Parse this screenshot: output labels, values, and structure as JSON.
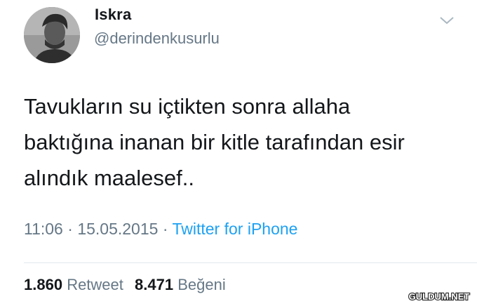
{
  "author": {
    "display_name": "Iskra",
    "username": "@derindenkusurlu",
    "avatar_icon": "profile-photo"
  },
  "menu_icon": "chevron-down-icon",
  "tweet": {
    "lines": [
      "Tavukların su içtikten sonra allaha",
      "baktığına inanan bir kitle tarafından esir",
      "alındık maalesef.."
    ],
    "time": "11:06",
    "date": "15.05.2015",
    "separator": "·",
    "source": "Twitter for iPhone"
  },
  "stats": {
    "retweets_count": "1.860",
    "retweets_label": "Retweet",
    "likes_count": "8.471",
    "likes_label": "Beğeni"
  },
  "watermark": "GULDUM.NET",
  "colors": {
    "text": "#14171a",
    "muted": "#657786",
    "link": "#1da1f2",
    "divider": "#e1e8ed"
  }
}
